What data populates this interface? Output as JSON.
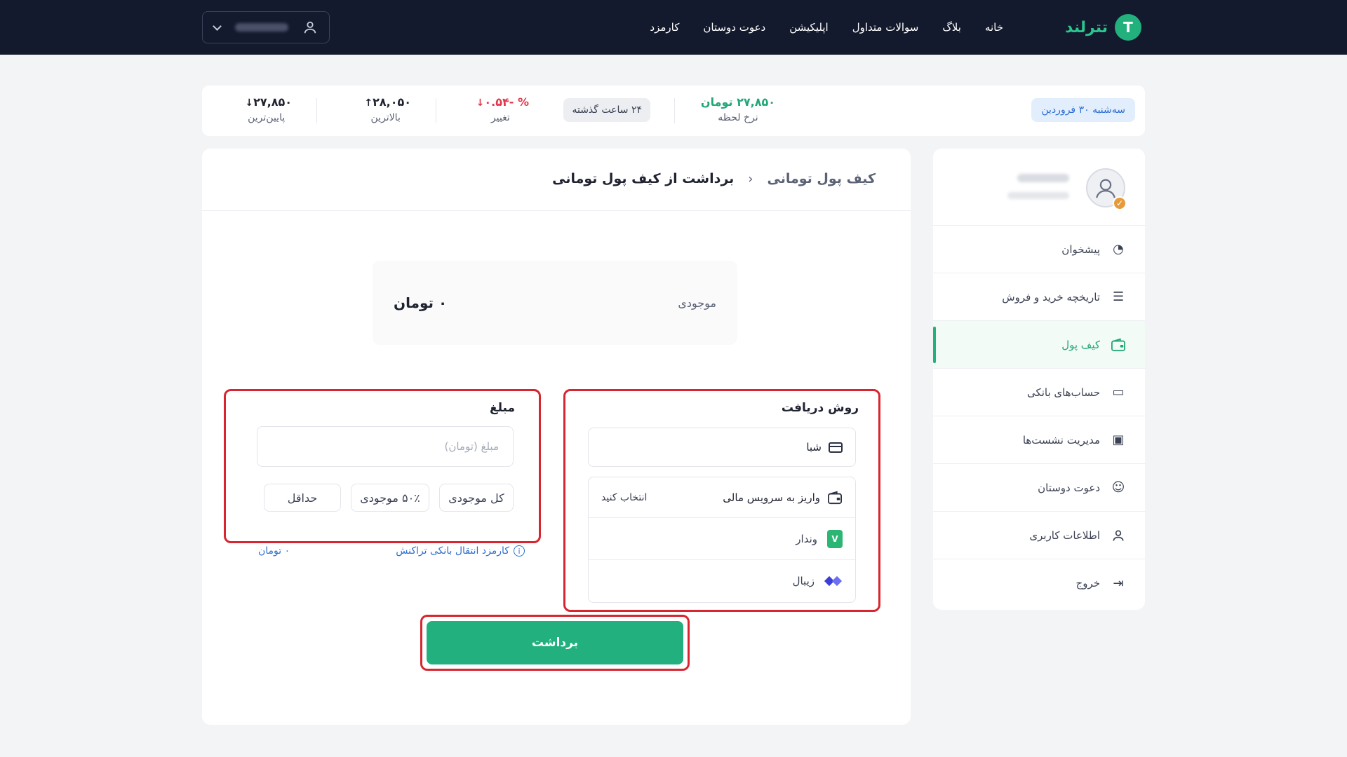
{
  "brand": {
    "logo_letter": "T",
    "name": "تترلند",
    "accent": "#22b07d"
  },
  "nav": [
    {
      "label": "خانه"
    },
    {
      "label": "بلاگ"
    },
    {
      "label": "سوالات متداول"
    },
    {
      "label": "اپلیکیشن"
    },
    {
      "label": "دعوت دوستان"
    },
    {
      "label": "کارمزد"
    }
  ],
  "ticker": {
    "date": "سه‌شنبه ۳۰ فروردین",
    "rate_value": "۲۷,۸۵۰ تومان",
    "rate_label": "نرخ لحظه",
    "period": "۲۴ ساعت گذشته",
    "change_value": "% -۰.۵۴",
    "change_label": "تغییر",
    "high_value": "۲۸,۰۵۰",
    "high_label": "بالاترین",
    "low_value": "۲۷,۸۵۰",
    "low_label": "پایین‌ترین"
  },
  "sidebar": {
    "items": [
      {
        "label": "پیشخوان",
        "icon": "pie-chart-icon"
      },
      {
        "label": "تاریخچه خرید و فروش",
        "icon": "history-list-icon"
      },
      {
        "label": "کیف پول",
        "icon": "wallet-icon",
        "active": true
      },
      {
        "label": "حساب‌های بانکی",
        "icon": "bank-card-icon"
      },
      {
        "label": "مدیریت نشست‌ها",
        "icon": "devices-icon"
      },
      {
        "label": "دعوت دوستان",
        "icon": "smile-icon"
      },
      {
        "label": "اطلاعات کاربری",
        "icon": "user-icon"
      },
      {
        "label": "خروج",
        "icon": "logout-icon"
      }
    ]
  },
  "main": {
    "breadcrumb_parent": "کیف پول تومانی",
    "breadcrumb_current": "برداشت از کیف پول تومانی",
    "balance_label": "موجودی",
    "balance_value": "۰ تومان",
    "amount": {
      "title": "مبلغ",
      "placeholder": "مبلغ (تومان)",
      "chip_all": "کل موجودی",
      "chip_half": "۵۰٪ موجودی",
      "chip_min": "حداقل"
    },
    "fee": {
      "label": "کارمزد انتقال بانکی تراکنش",
      "value": "۰ تومان"
    },
    "method": {
      "title": "روش دریافت",
      "sheba": "شبا",
      "service_label": "واریز به سرویس مالی",
      "service_select": "انتخاب کنید",
      "services": [
        {
          "label": "وندار"
        },
        {
          "label": "زیبال"
        }
      ]
    },
    "submit_label": "برداشت"
  }
}
